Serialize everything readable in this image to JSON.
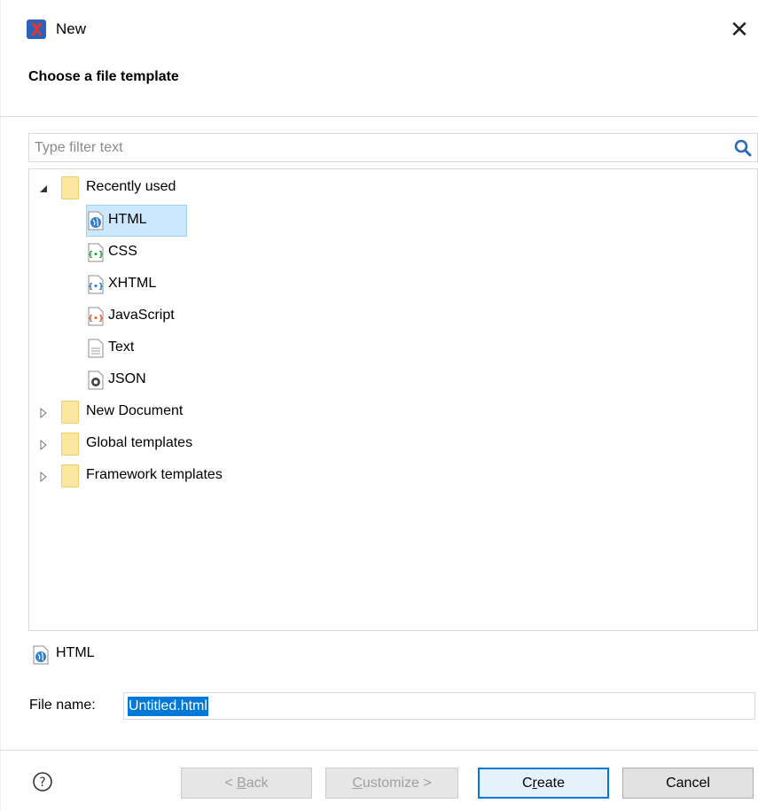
{
  "window": {
    "title": "New"
  },
  "header": {
    "title": "Choose a file template"
  },
  "filter": {
    "placeholder": "Type filter text"
  },
  "tree": {
    "recently_used": {
      "label": "Recently used",
      "items": [
        {
          "label": "HTML",
          "icon": "html-file-icon",
          "selected": true
        },
        {
          "label": "CSS",
          "icon": "css-file-icon"
        },
        {
          "label": "XHTML",
          "icon": "xhtml-file-icon"
        },
        {
          "label": "JavaScript",
          "icon": "javascript-file-icon"
        },
        {
          "label": "Text",
          "icon": "text-file-icon"
        },
        {
          "label": "JSON",
          "icon": "json-file-icon"
        }
      ]
    },
    "folders": [
      {
        "label": "New Document"
      },
      {
        "label": "Global templates"
      },
      {
        "label": "Framework templates"
      }
    ]
  },
  "selection": {
    "label": "HTML"
  },
  "file_name": {
    "label": "File name:",
    "value": "Untitled.html"
  },
  "buttons": {
    "back": {
      "label": "< Back",
      "pre": "< ",
      "mnemonic": "B",
      "post": "ack"
    },
    "customize": {
      "label": "Customize >",
      "mnemonic": "C",
      "post": "ustomize >"
    },
    "create": {
      "label": "Create",
      "pre": "C",
      "mnemonic": "r",
      "post": "eate"
    },
    "cancel": {
      "label": "Cancel"
    }
  },
  "colors": {
    "accent": "#0078d7",
    "selection_bg": "#cce8ff",
    "folder": "#fce7a0"
  }
}
